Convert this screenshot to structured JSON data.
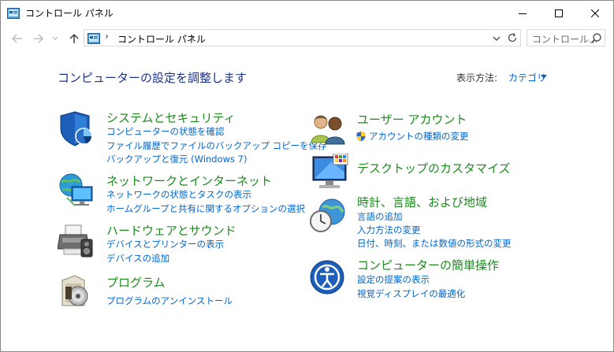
{
  "window": {
    "title": "コントロール パネル",
    "controls": {
      "minimize": "minimize",
      "maximize": "maximize",
      "close": "close"
    }
  },
  "nav": {
    "back": "back",
    "forward": "forward",
    "recent": "recent",
    "up": "up"
  },
  "address": {
    "path": "コントロール パネル",
    "sep1": "›",
    "sep2": "›"
  },
  "search": {
    "placeholder": "コントロール..."
  },
  "heading": "コンピューターの設定を調整します",
  "view_by": {
    "label": "表示方法:",
    "value": "カテゴリ"
  },
  "categories_left": [
    {
      "title": "システムとセキュリティ",
      "icon": "shield-icon",
      "links": [
        "コンピューターの状態を確認",
        "ファイル履歴でファイルのバックアップ コピーを保存",
        "バックアップと復元 (Windows 7)"
      ]
    },
    {
      "title": "ネットワークとインターネット",
      "icon": "network-globe-icon",
      "links": [
        "ネットワークの状態とタスクの表示",
        "ホームグループと共有に関するオプションの選択"
      ]
    },
    {
      "title": "ハードウェアとサウンド",
      "icon": "printer-speaker-icon",
      "links": [
        "デバイスとプリンターの表示",
        "デバイスの追加"
      ]
    },
    {
      "title": "プログラム",
      "icon": "programs-disc-icon",
      "links": [
        "プログラムのアンインストール"
      ]
    }
  ],
  "categories_right": [
    {
      "title": "ユーザー アカウント",
      "icon": "users-icon",
      "links": [
        "アカウントの種類の変更"
      ]
    },
    {
      "title": "デスクトップのカスタマイズ",
      "icon": "monitor-icon",
      "links": []
    },
    {
      "title": "時計、言語、および地域",
      "icon": "clock-globe-icon",
      "links": [
        "言語の追加",
        "入力方法の変更",
        "日付、時刻、または数値の形式の変更"
      ]
    },
    {
      "title": "コンピューターの簡単操作",
      "icon": "ease-of-access-icon",
      "links": [
        "設定の提案の表示",
        "視覚ディスプレイの最適化"
      ]
    }
  ],
  "colors": {
    "heading": "#1e3287",
    "category_title": "#1e8a1e",
    "link": "#0066cc"
  }
}
